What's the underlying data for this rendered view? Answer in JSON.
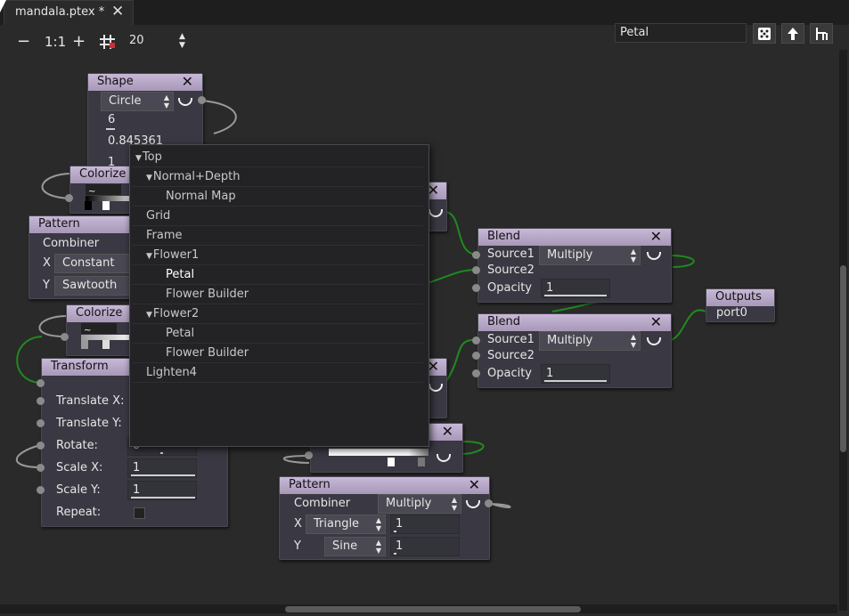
{
  "tab": {
    "title": "mandala.ptex *",
    "close": "✕"
  },
  "toolbar": {
    "zoom_out": "−",
    "zoom_reset": "1:1",
    "zoom_in": "+",
    "grid_value": "20",
    "search_value": "Petal"
  },
  "nodes": {
    "shape": {
      "title": "Shape",
      "close": "✕",
      "shape_value": "Circle",
      "edges": "6",
      "radius": "0.845361",
      "partial": "1"
    },
    "colorize1": {
      "title": "Colorize"
    },
    "pattern1": {
      "title": "Pattern",
      "combiner": "Combiner",
      "x_label": "X",
      "x_value": "Constant",
      "y_label": "Y",
      "y_value": "Sawtooth"
    },
    "colorize2": {
      "title": "Colorize"
    },
    "transform": {
      "title": "Transform",
      "translate_x": "Translate X:",
      "translate_y": "Translate Y:",
      "rotate": "Rotate:",
      "rotate_value": "0",
      "scale_x": "Scale X:",
      "scale_x_value": "1",
      "scale_y": "Scale Y:",
      "scale_y_value": "1",
      "repeat": "Repeat:"
    },
    "blend1": {
      "title": "Blend",
      "close": "✕",
      "source1": "Source1",
      "mode": "Multiply",
      "source2": "Source2",
      "opacity": "Opacity",
      "opacity_value": "1"
    },
    "blend2": {
      "title": "Blend",
      "close": "✕",
      "source1": "Source1",
      "mode": "Multiply",
      "source2": "Source2",
      "opacity": "Opacity",
      "opacity_value": "1"
    },
    "outputs": {
      "title": "Outputs",
      "port": "port0"
    },
    "colorize3": {
      "close": "✕"
    },
    "pattern2": {
      "title": "Pattern",
      "close": "✕",
      "combiner": "Combiner",
      "mode": "Multiply",
      "x_label": "X",
      "x_value": "Triangle",
      "x_num": "1",
      "y_label": "Y",
      "y_value": "Sine",
      "y_num": "1"
    }
  },
  "tree": [
    {
      "label": "Top",
      "expanded": true,
      "indent": 0
    },
    {
      "label": "Normal+Depth",
      "expanded": true,
      "indent": 1
    },
    {
      "label": "Normal Map",
      "indent": 2
    },
    {
      "label": "Grid",
      "indent": 1
    },
    {
      "label": "Frame",
      "indent": 1
    },
    {
      "label": "Flower1",
      "expanded": true,
      "indent": 1
    },
    {
      "label": "Petal",
      "indent": 2,
      "selected": true
    },
    {
      "label": "Flower Builder",
      "indent": 2
    },
    {
      "label": "Flower2",
      "expanded": true,
      "indent": 1
    },
    {
      "label": "Petal",
      "indent": 2
    },
    {
      "label": "Flower Builder",
      "indent": 2
    },
    {
      "label": "Lighten4",
      "indent": 1
    }
  ],
  "colors": {
    "background": "#2a2a2a",
    "node_title": "#b8a8c8",
    "wire": "#1f8a1f"
  }
}
